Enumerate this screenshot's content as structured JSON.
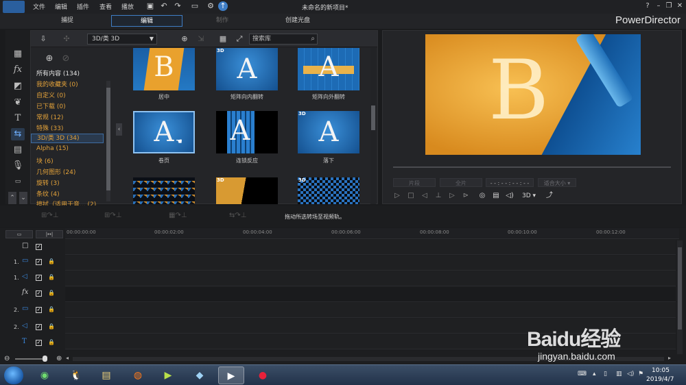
{
  "menu": {
    "items": [
      "文件",
      "编辑",
      "插件",
      "查看",
      "播放"
    ],
    "title": "未命名的新项目*"
  },
  "modes": {
    "tabs": [
      "捕捉",
      "编辑",
      "制作",
      "创建光盘"
    ],
    "brand": "PowerDirector"
  },
  "library": {
    "category_select": "3D/类 3D",
    "search_placeholder": "搜索库",
    "categories": [
      "所有内容 (134)",
      "我的收藏夹 (0)",
      "自定义 (0)",
      "已下载 (0)",
      "常规 (12)",
      "特殊 (33)",
      "3D/类 3D (34)",
      "Alpha (15)",
      "块 (6)",
      "几何图形 (24)",
      "旋转 (3)",
      "条纹 (4)",
      "擦拭（适用于音..."
    ],
    "categories_tail": "(2)",
    "thumbnails": [
      {
        "label": "居中",
        "glyph": "B",
        "badge": ""
      },
      {
        "label": "矩阵向内翻转",
        "glyph": "A",
        "badge": "3D"
      },
      {
        "label": "矩阵向外翻转",
        "glyph": "A",
        "badge": ""
      },
      {
        "label": "卷页",
        "glyph": "A",
        "badge": ""
      },
      {
        "label": "连锁反应",
        "glyph": "A",
        "badge": ""
      },
      {
        "label": "落下",
        "glyph": "A",
        "badge": "3D"
      },
      {
        "label": "",
        "glyph": "",
        "badge": ""
      },
      {
        "label": "",
        "glyph": "",
        "badge": "3D"
      },
      {
        "label": "",
        "glyph": "",
        "badge": "3D"
      }
    ]
  },
  "preview": {
    "glyph": "B",
    "btn_clip": "片段",
    "btn_all": "全片",
    "timecode": "- - : - - : - - : - -",
    "fit": "适合大小",
    "mode3d": "3D"
  },
  "actionbar": {
    "hint": "拖动所选转场至视频轨。"
  },
  "timeline": {
    "ruler": [
      "00:00:00:00",
      "00:00:02:00",
      "00:00:04:00",
      "00:00:06:00",
      "00:00:08:00",
      "00:00:10:00",
      "00:00:12:00"
    ],
    "tracks": [
      {
        "num": "",
        "icon": "□"
      },
      {
        "num": "1.",
        "icon": "▭"
      },
      {
        "num": "1.",
        "icon": "◁"
      },
      {
        "num": "",
        "icon": "fx"
      },
      {
        "num": "2.",
        "icon": "▭"
      },
      {
        "num": "2.",
        "icon": "◁"
      },
      {
        "num": "",
        "icon": "T"
      }
    ]
  },
  "taskbar": {
    "time": "10:05",
    "date": "2019/4/7"
  },
  "watermark": {
    "text": "Baidu经验",
    "sub": "jingyan.baidu.com"
  }
}
